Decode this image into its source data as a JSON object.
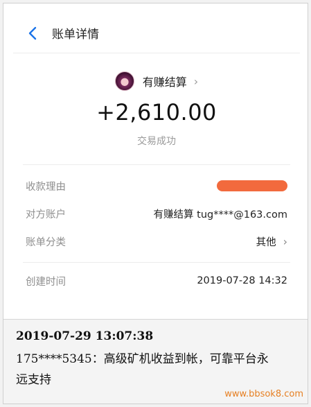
{
  "header": {
    "title": "账单详情"
  },
  "merchant": {
    "name": "有赚结算"
  },
  "transaction": {
    "amount": "+2,610.00",
    "status": "交易成功"
  },
  "details": {
    "reason_label": "收款理由",
    "counterparty_label": "对方账户",
    "counterparty_value": "有赚结算 tug****@163.com",
    "category_label": "账单分类",
    "category_value": "其他",
    "created_label": "创建时间",
    "created_value": "2019-07-28 14:32"
  },
  "note": {
    "timestamp": "2019-07-29 13:07:38",
    "text": "175****5345：高级矿机收益到帐，可靠平台永远支持"
  },
  "watermark": "www.bbsok8.com",
  "colors": {
    "redaction": "#f26a3d",
    "watermark": "#e67f22"
  },
  "icons": [
    "back-arrow-icon",
    "chevron-right-icon",
    "avatar"
  ]
}
